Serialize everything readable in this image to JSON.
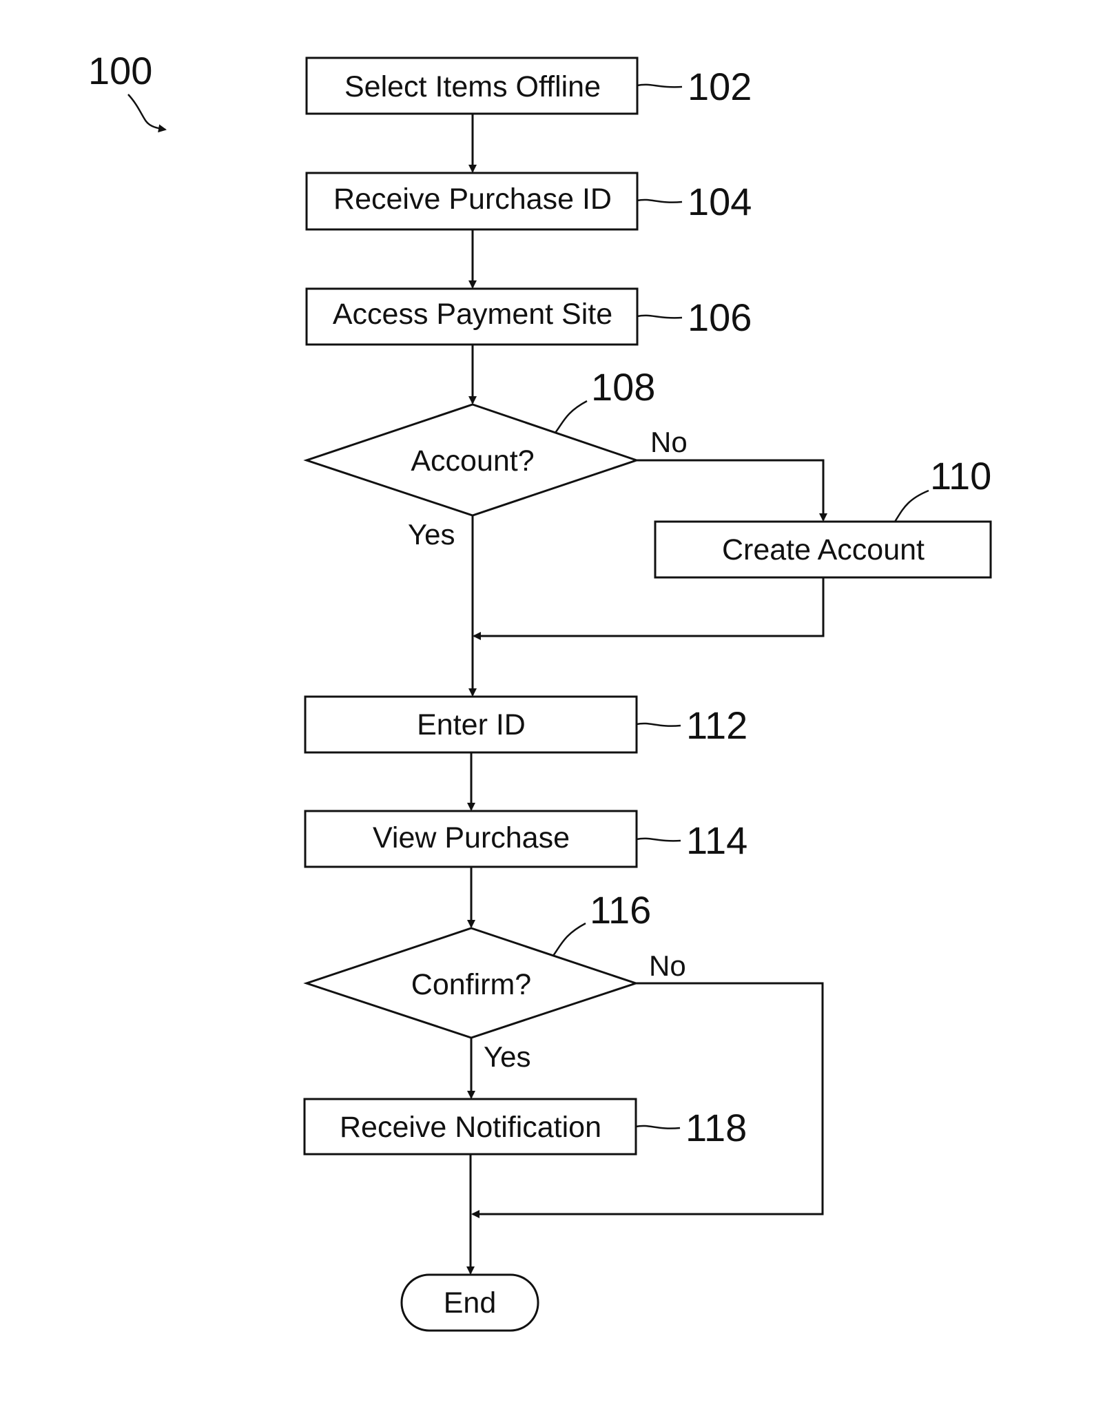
{
  "figure": {
    "ref_label": "100",
    "steps": {
      "s102": {
        "text": "Select Items Offline",
        "ref": "102"
      },
      "s104": {
        "text": "Receive Purchase ID",
        "ref": "104"
      },
      "s106": {
        "text": "Access Payment Site",
        "ref": "106"
      },
      "d108": {
        "text": "Account?",
        "ref": "108",
        "yes": "Yes",
        "no": "No"
      },
      "s110": {
        "text": "Create Account",
        "ref": "110"
      },
      "s112": {
        "text": "Enter ID",
        "ref": "112"
      },
      "s114": {
        "text": "View Purchase",
        "ref": "114"
      },
      "d116": {
        "text": "Confirm?",
        "ref": "116",
        "yes": "Yes",
        "no": "No"
      },
      "s118": {
        "text": "Receive Notification",
        "ref": "118"
      },
      "end": {
        "text": "End"
      }
    }
  }
}
